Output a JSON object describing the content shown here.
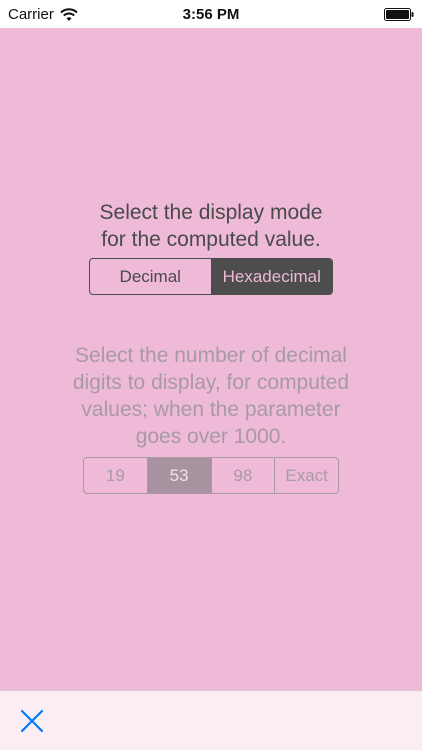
{
  "status_bar": {
    "carrier": "Carrier",
    "time": "3:56 PM",
    "wifi_icon": "wifi-icon",
    "battery_icon": "battery-icon"
  },
  "display_mode": {
    "prompt_line1": "Select the display mode",
    "prompt_line2": "for the computed value.",
    "options": [
      "Decimal",
      "Hexadecimal"
    ],
    "selected": "Hexadecimal"
  },
  "decimal_digits": {
    "prompt_line1": "Select the number of decimal",
    "prompt_line2": "digits to display, for computed",
    "prompt_line3": "values; when the parameter",
    "prompt_line4": "goes over 1000.",
    "options": [
      "19",
      "53",
      "98",
      "Exact"
    ],
    "selected": "53",
    "disabled": true
  },
  "toolbar": {
    "close_icon": "close-icon"
  },
  "colors": {
    "background": "#eebad7",
    "accent": "#007aff",
    "segment_dark": "#4d4d4d",
    "segment_disabled": "#a89aa3"
  }
}
